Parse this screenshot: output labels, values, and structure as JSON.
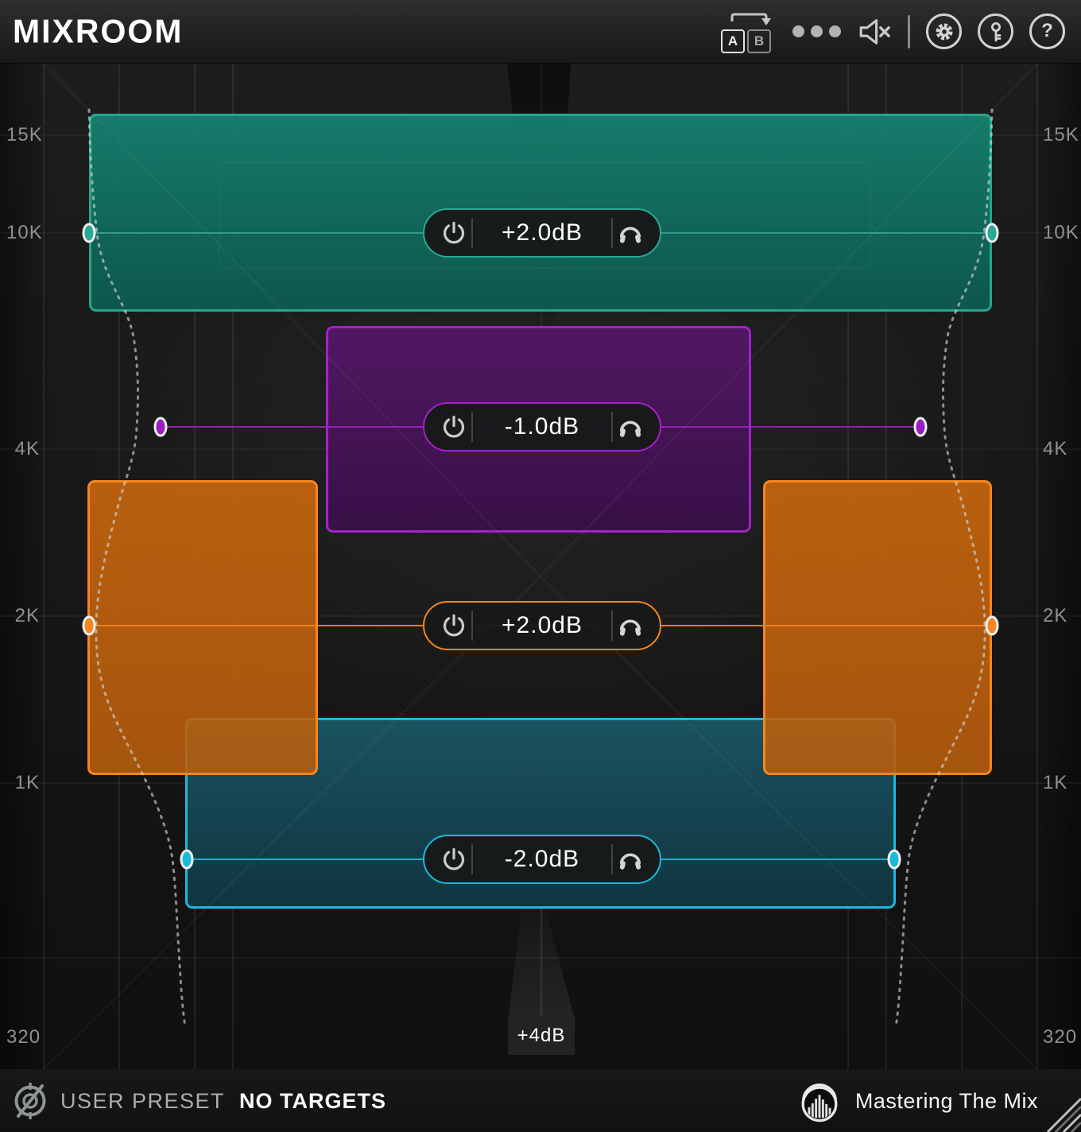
{
  "header": {
    "title": "MIXROOM",
    "ab_toggle": {
      "a": "A",
      "b": "B"
    },
    "help_glyph": "?"
  },
  "frequency_labels": [
    "15K",
    "10K",
    "4K",
    "2K",
    "1K",
    "320"
  ],
  "bands": [
    {
      "name": "high",
      "color": "#2aa893",
      "gain": "+2.0dB"
    },
    {
      "name": "upper-mid",
      "color": "#a321c9",
      "gain": "-1.0dB"
    },
    {
      "name": "mid",
      "color": "#f6861f",
      "gain": "+2.0dB"
    },
    {
      "name": "low-mid",
      "color": "#1cb9de",
      "gain": "-2.0dB"
    }
  ],
  "scale": {
    "gain_label": "+4dB"
  },
  "footer": {
    "preset_type": "USER PRESET",
    "preset_name": "NO TARGETS",
    "brand": "Mastering The Mix"
  }
}
